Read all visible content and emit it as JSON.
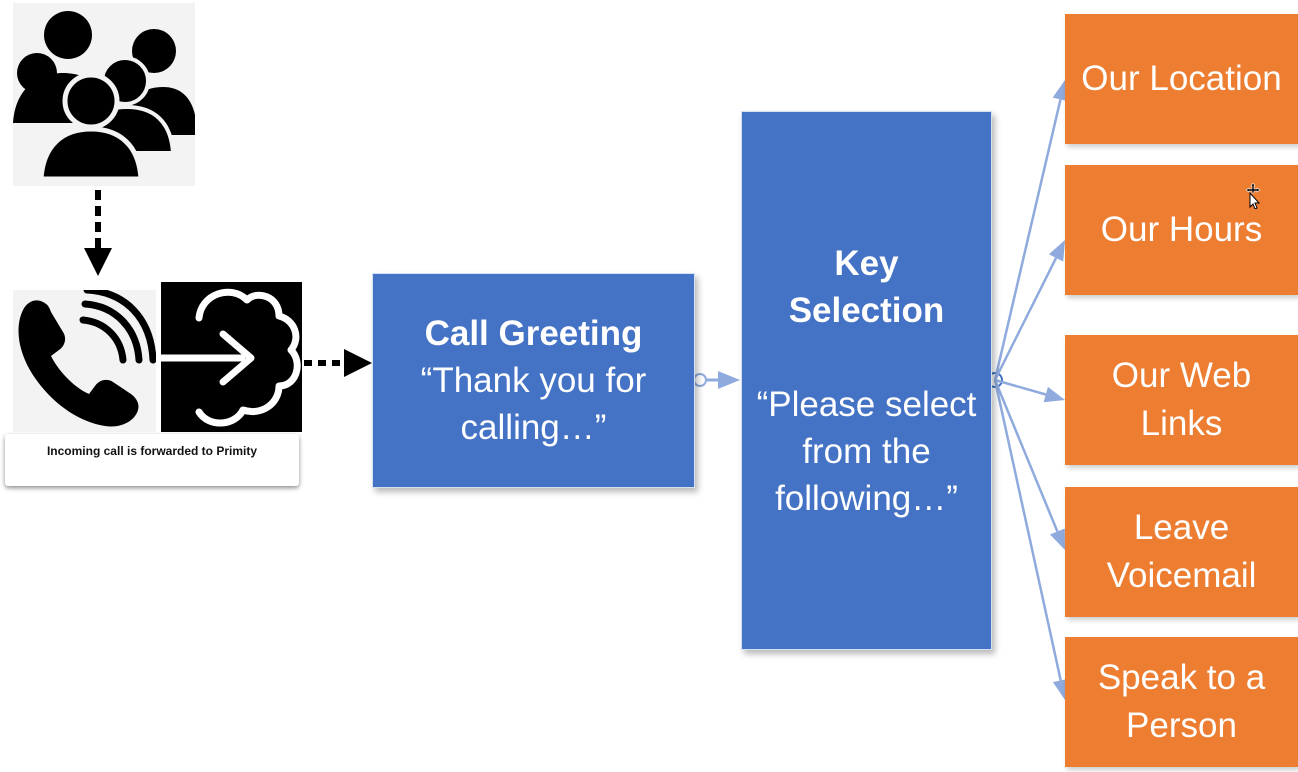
{
  "colors": {
    "blue_box": "#4472c4",
    "orange_box": "#ed7d31",
    "connector": "#8faadc",
    "icon": "#000000"
  },
  "icons": {
    "people": "people-group-icon",
    "phone": "phone-ringing-icon",
    "cloud": "cloud-arrow-in-icon"
  },
  "caption": "Incoming call is forwarded to Primity",
  "greeting": {
    "title": "Call Greeting",
    "quote": "“Thank you for calling…”"
  },
  "key_selection": {
    "title": "Key Selection",
    "quote": "“Please select from the following…”"
  },
  "options": [
    {
      "label": "Our Location"
    },
    {
      "label": "Our Hours"
    },
    {
      "label": "Our Web Links"
    },
    {
      "label": "Leave Voicemail"
    },
    {
      "label": "Speak to a Person"
    }
  ]
}
